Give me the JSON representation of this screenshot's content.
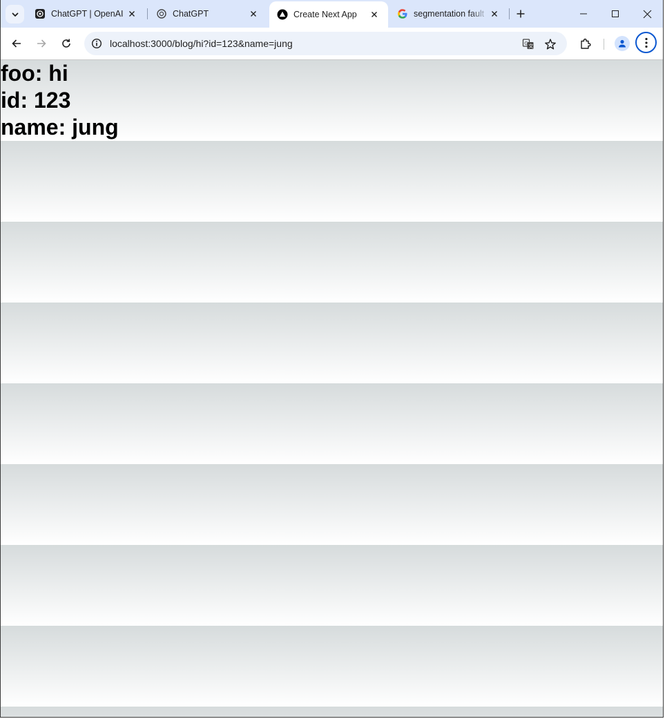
{
  "browser": {
    "tabs": [
      {
        "title": "ChatGPT | OpenAI",
        "icon": "openai-icon",
        "active": false
      },
      {
        "title": "ChatGPT",
        "icon": "openai-icon",
        "active": false
      },
      {
        "title": "Create Next App",
        "icon": "nextjs-triangle-icon",
        "active": true
      },
      {
        "title": "segmentation fault",
        "icon": "google-icon",
        "active": false
      }
    ],
    "url": "localhost:3000/blog/hi?id=123&name=jung",
    "accent_color": "#0b57d0",
    "tabstrip_color": "#dbe6fb"
  },
  "page": {
    "lines": [
      "foo: hi",
      "id: 123",
      "name: jung"
    ],
    "stripe_colors": [
      "#d6dbdc",
      "#ffffff"
    ]
  }
}
